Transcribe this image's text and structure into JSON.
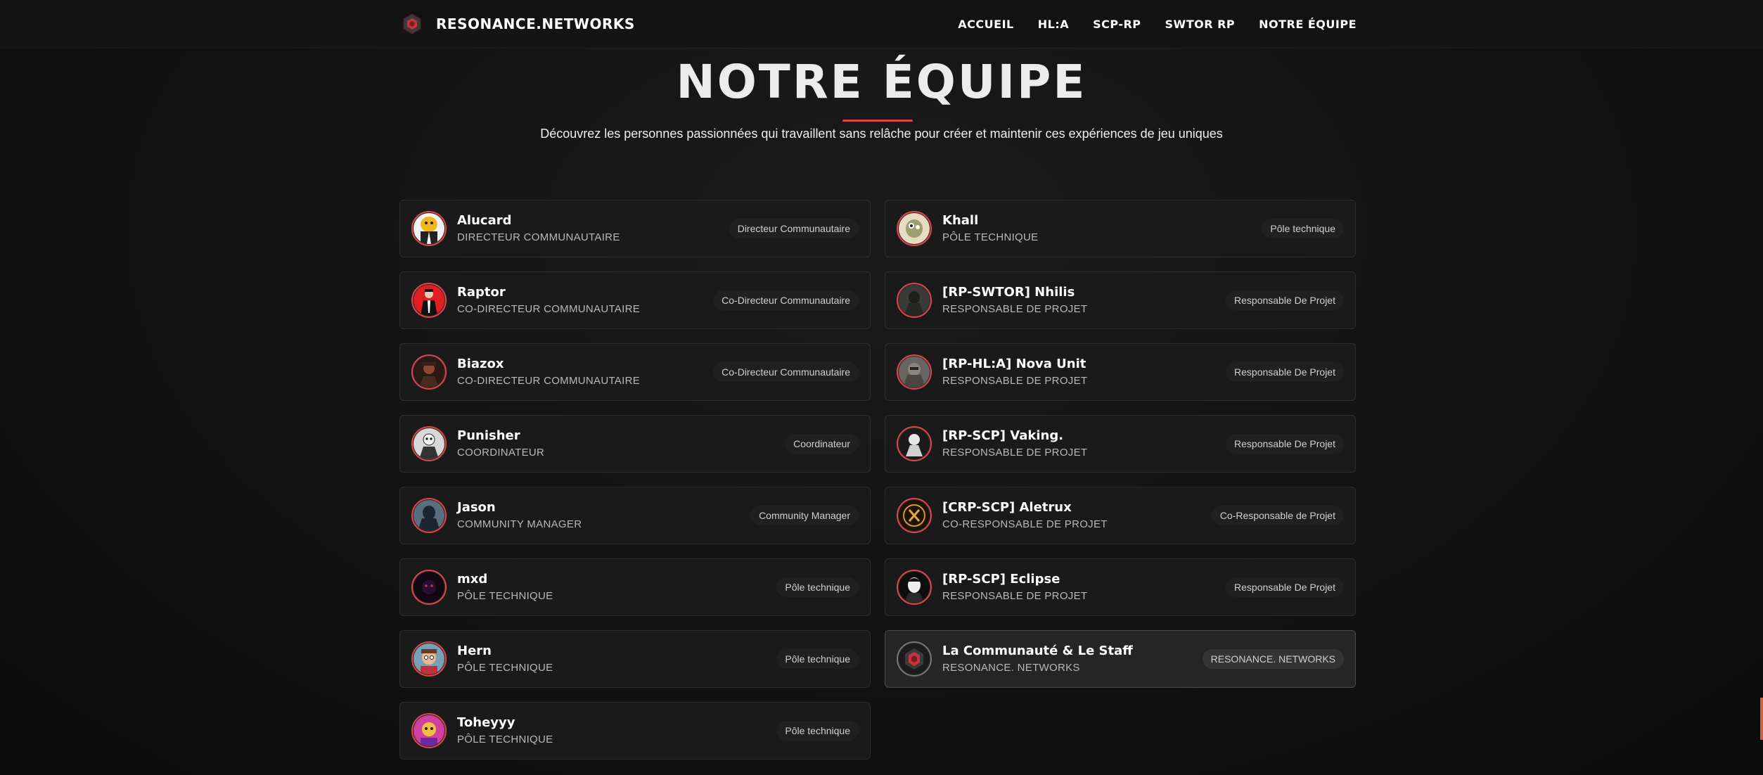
{
  "brand": {
    "name": "RESONANCE.NETWORKS",
    "icon": "hexagon-logo-icon",
    "accent": "#e0454e"
  },
  "nav": [
    "ACCUEIL",
    "HL:A",
    "SCP-RP",
    "SWTOR RP",
    "NOTRE ÉQUIPE"
  ],
  "header": {
    "title": "NOTRE ÉQUIPE",
    "subtitle": "Découvrez les personnes passionnées qui travaillent sans relâche pour créer et maintenir ces expériences de jeu uniques"
  },
  "team_left": [
    {
      "name": "Alucard",
      "role": "DIRECTEUR COMMUNAUTAIRE",
      "badge": "Directeur Communautaire",
      "avatar": "yellow-character-avatar"
    },
    {
      "name": "Raptor",
      "role": "CO-DIRECTEUR COMMUNAUTAIRE",
      "badge": "Co-Directeur Communautaire",
      "avatar": "red-suit-avatar"
    },
    {
      "name": "Biazox",
      "role": "CO-DIRECTEUR COMMUNAUTAIRE",
      "badge": "Co-Directeur Communautaire",
      "avatar": "dark-portrait-avatar"
    },
    {
      "name": "Punisher",
      "role": "COORDINATEUR",
      "badge": "Coordinateur",
      "avatar": "masked-figure-avatar"
    },
    {
      "name": "Jason",
      "role": "COMMUNITY MANAGER",
      "badge": "Community Manager",
      "avatar": "hooded-figure-avatar"
    },
    {
      "name": "mxd",
      "role": "PÔLE TECHNIQUE",
      "badge": "Pôle technique",
      "avatar": "dark-purple-avatar"
    },
    {
      "name": "Hern",
      "role": "PÔLE TECHNIQUE",
      "badge": "Pôle technique",
      "avatar": "cartoon-face-avatar"
    },
    {
      "name": "Toheyyy",
      "role": "PÔLE TECHNIQUE",
      "badge": "Pôle technique",
      "avatar": "pink-cartoon-avatar"
    }
  ],
  "team_right": [
    {
      "name": "Khall",
      "role": "PÔLE TECHNIQUE",
      "badge": "Pôle technique",
      "avatar": "creature-avatar"
    },
    {
      "name": "[RP-SWTOR] Nhilis",
      "role": "RESPONSABLE DE PROJET",
      "badge": "Responsable De Projet",
      "avatar": "dark-soldier-avatar"
    },
    {
      "name": "[RP-HL:A] Nova Unit",
      "role": "RESPONSABLE DE PROJET",
      "badge": "Responsable De Projet",
      "avatar": "armored-unit-avatar"
    },
    {
      "name": "[RP-SCP] Vaking.",
      "role": "RESPONSABLE DE PROJET",
      "badge": "Responsable De Projet",
      "avatar": "white-creature-avatar"
    },
    {
      "name": "[CRP-SCP] Aletrux",
      "role": "CO-RESPONSABLE DE PROJET",
      "badge": "Co-Responsable de Projet",
      "avatar": "gold-x-emblem-avatar"
    },
    {
      "name": "[RP-SCP] Eclipse",
      "role": "RESPONSABLE DE PROJET",
      "badge": "Responsable De Projet",
      "avatar": "white-mask-avatar"
    },
    {
      "name": "La Communauté & Le Staff",
      "role": "RESONANCE. NETWORKS",
      "badge": "RESONANCE. NETWORKS",
      "avatar": "hexagon-logo-avatar"
    }
  ],
  "colors": {
    "background": "#121212",
    "card": "#1a1a1a",
    "card_border": "#2e2e2e",
    "accent_red": "#e0454e"
  }
}
